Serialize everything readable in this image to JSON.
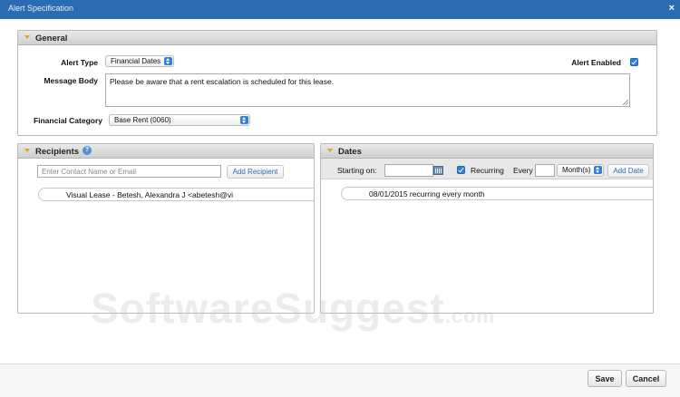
{
  "window": {
    "title": "Alert Specification",
    "close_symbol": "×"
  },
  "general": {
    "title": "General",
    "alert_type_label": "Alert Type",
    "alert_type_value": "Financial Dates",
    "alert_enabled_label": "Alert Enabled",
    "message_body_label": "Message Body",
    "message_body_value": "Please be aware that a rent escalation is scheduled for this lease.",
    "financial_category_label": "Financial Category",
    "financial_category_value": "Base Rent (0060)"
  },
  "recipients": {
    "title": "Recipients",
    "help_symbol": "?",
    "contact_placeholder": "Enter Contact Name or Email",
    "add_button": "Add Recipient",
    "items": [
      "Visual Lease - Betesh, Alexandra J <abetesh@vi"
    ]
  },
  "dates": {
    "title": "Dates",
    "starting_on_label": "Starting on:",
    "recurring_label": "Recurring",
    "every_label": "Every",
    "unit_value": "Month(s)",
    "add_button": "Add Date",
    "items": [
      "08/01/2015 recurring every month"
    ]
  },
  "footer": {
    "save": "Save",
    "cancel": "Cancel"
  },
  "watermark": {
    "main": "SoftwareSuggest",
    "suffix": ".com"
  },
  "colors": {
    "titlebar": "#2a6bb1",
    "accent": "#2f7fe0",
    "triangle": "#e0a52a"
  }
}
